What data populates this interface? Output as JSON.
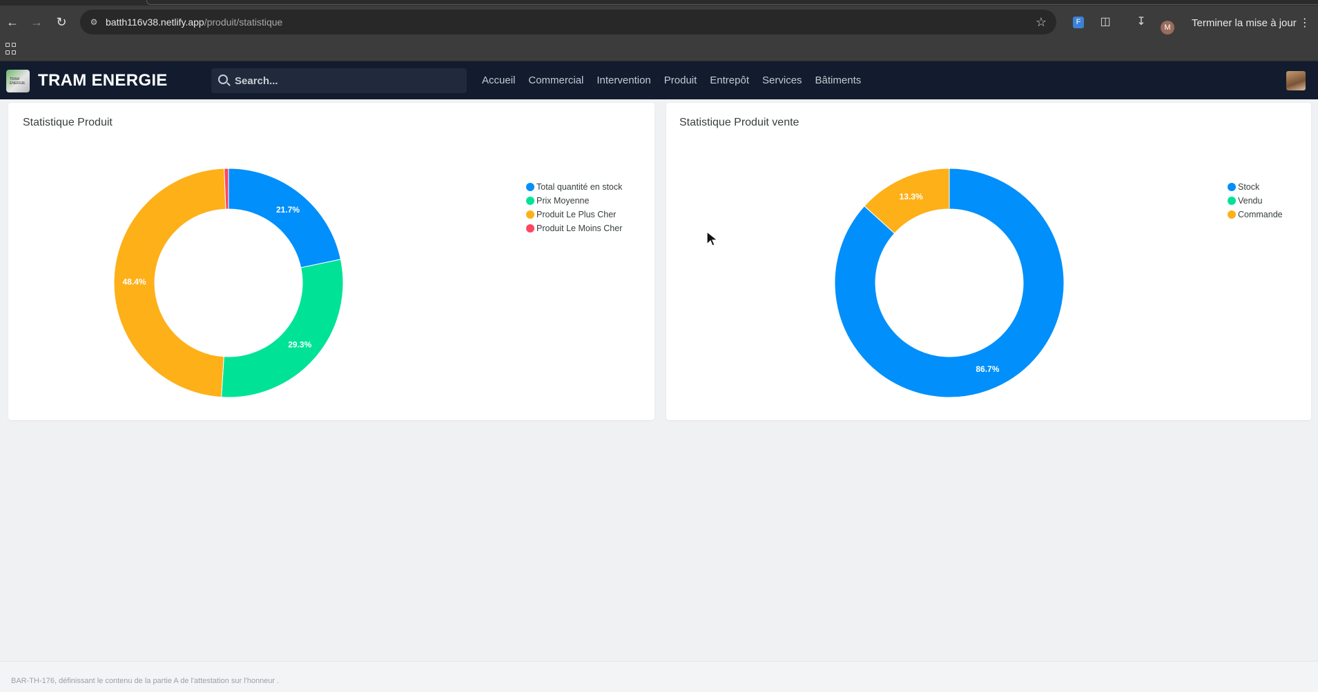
{
  "browser": {
    "url_host": "batth116v38.netlify.app",
    "url_path": "/produit/statistique",
    "update_button": "Terminer la mise à jour",
    "profile_initial": "M"
  },
  "app": {
    "brand": "TRAM ENERGIE",
    "logo_text": "TRAM ENERGIE",
    "search_placeholder": "Search...",
    "menu": [
      "Accueil",
      "Commercial",
      "Intervention",
      "Produit",
      "Entrepôt",
      "Services",
      "Bâtiments"
    ]
  },
  "colors": {
    "blue": "#008ffb",
    "green": "#00e396",
    "orange": "#feb019",
    "red": "#ff4560",
    "navbar": "#121c2e"
  },
  "chart_data": [
    {
      "type": "pie",
      "title": "Statistique Produit",
      "legend_position": "top-right",
      "donut": true,
      "series": [
        {
          "name": "Total quantité en stock",
          "percent": 21.7,
          "label": "21.7%",
          "color": "#008ffb"
        },
        {
          "name": "Prix Moyenne",
          "percent": 29.3,
          "label": "29.3%",
          "color": "#00e396"
        },
        {
          "name": "Produit Le Plus Cher",
          "percent": 48.4,
          "label": "48.4%",
          "color": "#feb019"
        },
        {
          "name": "Produit Le Moins Cher",
          "percent": 0.6,
          "label": "",
          "color": "#ff4560"
        }
      ]
    },
    {
      "type": "pie",
      "title": "Statistique Produit vente",
      "legend_position": "top-right",
      "donut": true,
      "series": [
        {
          "name": "Stock",
          "percent": 86.7,
          "label": "86.7%",
          "color": "#008ffb"
        },
        {
          "name": "Vendu",
          "percent": 0,
          "label": "",
          "color": "#00e396"
        },
        {
          "name": "Commande",
          "percent": 13.3,
          "label": "13.3%",
          "color": "#feb019"
        }
      ]
    }
  ],
  "footer": {
    "text": "BAR-TH-176, définissant le contenu de la partie A de l'attestation sur l'honneur ."
  }
}
